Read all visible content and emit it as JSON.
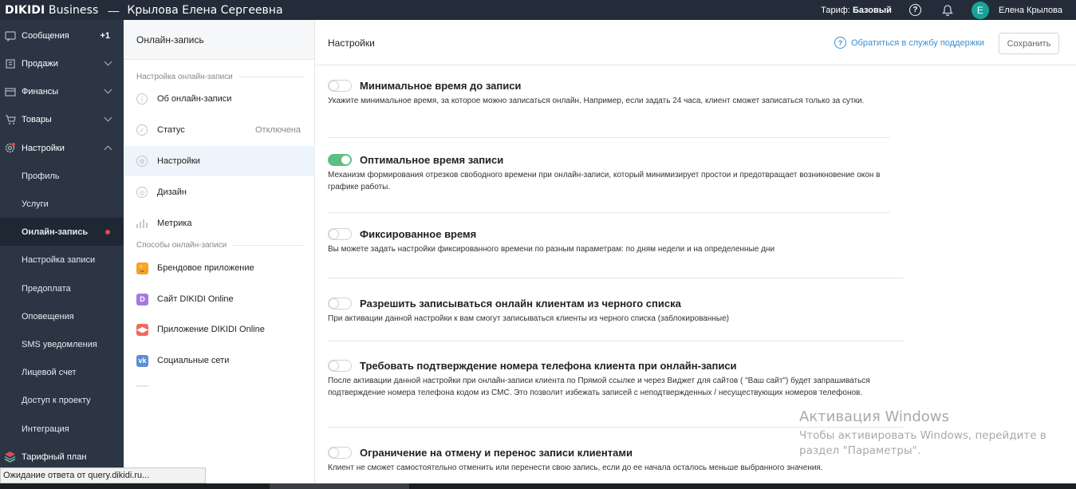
{
  "topbar": {
    "brand": "DIKIDI",
    "brand_suffix": " Business",
    "separator": "—",
    "owner": "Крылова Елена Сергеевна",
    "tariff_label": "Тариф:",
    "tariff_value": "Базовый",
    "avatar_letter": "Е",
    "user_name": "Елена Крылова"
  },
  "sidebar": {
    "messages": "Сообщения",
    "messages_badge": "+1",
    "sales": "Продажи",
    "finance": "Финансы",
    "goods": "Товары",
    "settings": "Настройки",
    "sub": [
      "Профиль",
      "Услуги",
      "Онлайн-запись",
      "Настройка записи",
      "Предоплата",
      "Оповещения",
      "SMS уведомления",
      "Лицевой счет",
      "Доступ к проекту",
      "Интеграция"
    ],
    "plan": "Тарифный план"
  },
  "statusbar": "Ожидание ответа от query.dikidi.ru...",
  "midpanel": {
    "header": "Онлайн-запись",
    "group1": "Настройка онлайн-записи",
    "about": "Об онлайн-записи",
    "status": "Статус",
    "status_value": "Отключена",
    "settings": "Настройки",
    "design": "Дизайн",
    "metrics": "Метрика",
    "group2": "Способы онлайн-записи",
    "brand_app": "Брендовое приложение",
    "site": "Сайт DIKIDI Online",
    "app": "Приложение DIKIDI Online",
    "social": "Социальные сети"
  },
  "main": {
    "title": "Настройки",
    "support": "Обратиться в службу поддержки",
    "save": "Сохранить",
    "settings": [
      {
        "title": "Минимальное время до записи",
        "desc": "Укажите минимальное время, за которое можно записаться онлайн. Например, если задать 24 часа, клиент сможет записаться только за сутки.",
        "on": false
      },
      {
        "title": "Оптимальное время записи",
        "desc": "Механизм формирования отрезков свободного времени при онлайн-записи, который минимизирует простои и предотвращает возникновение окон в графике работы.",
        "on": true
      },
      {
        "title": "Фиксированное время",
        "desc": "Вы можете задать настройки фиксированного времени по разным параметрам: по дням недели и на определенные дни",
        "on": false
      },
      {
        "title": "Разрешить записываться онлайн клиентам из черного списка",
        "desc": "При активации данной настройки к вам смогут записываться клиенты из черного списка (заблокированные)",
        "on": false
      },
      {
        "title": "Требовать подтверждение номера телефона клиента при онлайн-записи",
        "desc": "После активации данной настройки при онлайн-записи клиента по Прямой ссылке и через Виджет для сайтов ( \"Ваш сайт\") будет запрашиваться подтверждение номера телефона кодом из СМС. Это позволит избежать записей с неподтвержденных / несуществующих номеров телефонов.",
        "on": false
      },
      {
        "title": "Ограничение на отмену и перенос записи клиентами",
        "desc": "Клиент не сможет самостоятельно отменить или перенести свою запись, если до ее начала осталось меньше выбранного значения.",
        "on": false
      }
    ]
  },
  "watermark": {
    "title": "Активация Windows",
    "text": "Чтобы активировать Windows, перейдите в раздел \"Параметры\"."
  }
}
